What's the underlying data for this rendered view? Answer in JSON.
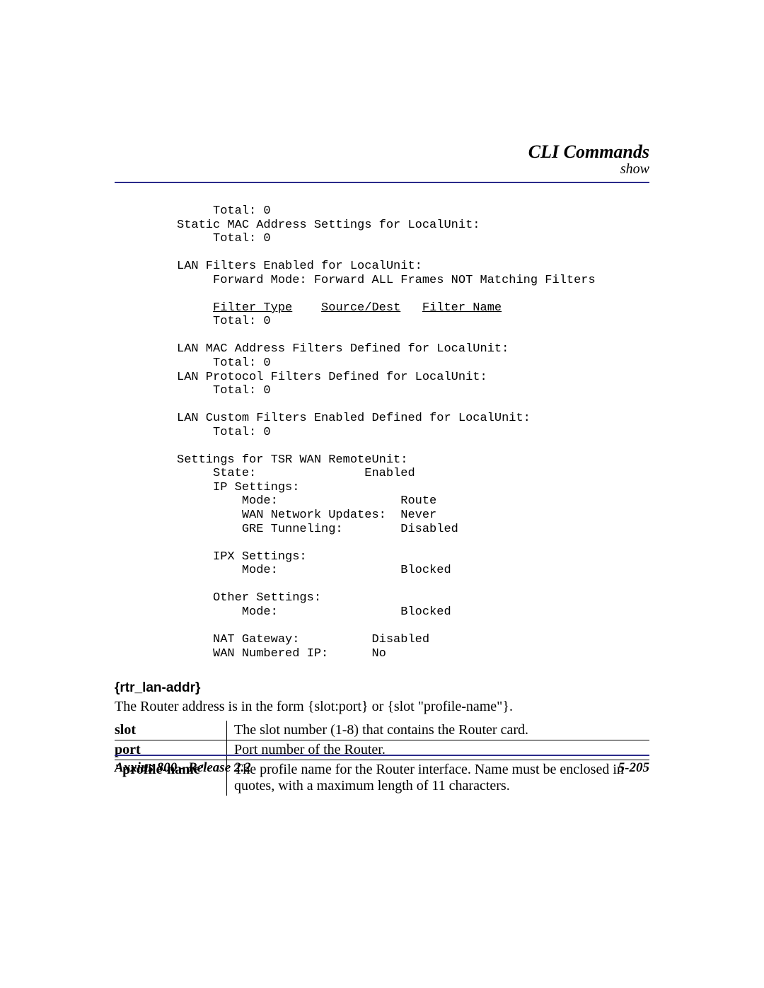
{
  "header": {
    "title": "CLI Commands",
    "subtitle": "show"
  },
  "cli": {
    "l1": "     Total: 0",
    "l2": "Static MAC Address Settings for LocalUnit:",
    "l3": "     Total: 0",
    "l5": "LAN Filters Enabled for LocalUnit:",
    "l6": "     Forward Mode: Forward ALL Frames NOT Matching Filters",
    "hdr_filter_type": "Filter Type",
    "hdr_src_dest": "Source/Dest",
    "hdr_filter_name": "Filter Name",
    "l8": "     Total: 0",
    "l10": "LAN MAC Address Filters Defined for LocalUnit:",
    "l11": "     Total: 0",
    "l12": "LAN Protocol Filters Defined for LocalUnit:",
    "l13": "     Total: 0",
    "l15": "LAN Custom Filters Enabled Defined for LocalUnit:",
    "l16": "     Total: 0",
    "l18": "Settings for TSR WAN RemoteUnit:",
    "l19": "     State:               Enabled",
    "l20": "     IP Settings:",
    "l21": "         Mode:                 Route",
    "l22": "         WAN Network Updates:  Never",
    "l23": "         GRE Tunneling:        Disabled",
    "l25": "     IPX Settings:",
    "l26": "         Mode:                 Blocked",
    "l28": "     Other Settings:",
    "l29": "         Mode:                 Blocked",
    "l31": "     NAT Gateway:          Disabled",
    "l32": "     WAN Numbered IP:      No"
  },
  "section": {
    "heading": "{rtr_lan-addr}",
    "paragraph": "The Router address is in the form {slot:port} or {slot \"profile-name\"}.",
    "rows": [
      {
        "term": "slot",
        "desc": "The slot number (1-8) that contains the Router card."
      },
      {
        "term": "port",
        "desc": "Port number of the Router."
      },
      {
        "term": "\"profile-name\"",
        "desc": "The profile name for the Router interface. Name must be enclosed in quotes, with a maximum length of 11 characters."
      }
    ]
  },
  "footer": {
    "left": "Axxius 800 - Release 2.2",
    "right": "5-205"
  }
}
